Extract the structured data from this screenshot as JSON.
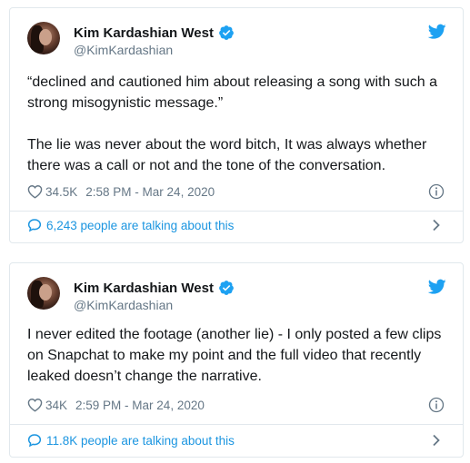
{
  "colors": {
    "accent": "#1b95e0",
    "secondary_text": "#657786",
    "border": "#e1e8ed",
    "verified": "#1da1f2"
  },
  "tweets": [
    {
      "author": {
        "name": "Kim Kardashian West",
        "handle": "@KimKardashian",
        "verified": true
      },
      "paragraphs": [
        "“declined and cautioned him about releasing a song with such a strong misogynistic message.”",
        "The lie was never about the word bitch, It was always whether there was a call or not and the tone of the conversation."
      ],
      "likes": "34.5K",
      "timestamp": "2:58 PM - Mar 24, 2020",
      "conversation": "6,243 people are talking about this",
      "icons": [
        "avatar",
        "verified-badge-icon",
        "twitter-bird-icon",
        "heart-icon",
        "info-icon",
        "speech-bubble-icon",
        "chevron-right-icon"
      ]
    },
    {
      "author": {
        "name": "Kim Kardashian West",
        "handle": "@KimKardashian",
        "verified": true
      },
      "paragraphs": [
        "I never edited the footage (another lie) - I only posted a few clips on Snapchat to make my point and the full video that recently leaked doesn’t change the narrative."
      ],
      "likes": "34K",
      "timestamp": "2:59 PM - Mar 24, 2020",
      "conversation": "11.8K people are talking about this",
      "icons": [
        "avatar",
        "verified-badge-icon",
        "twitter-bird-icon",
        "heart-icon",
        "info-icon",
        "speech-bubble-icon",
        "chevron-right-icon"
      ]
    }
  ]
}
